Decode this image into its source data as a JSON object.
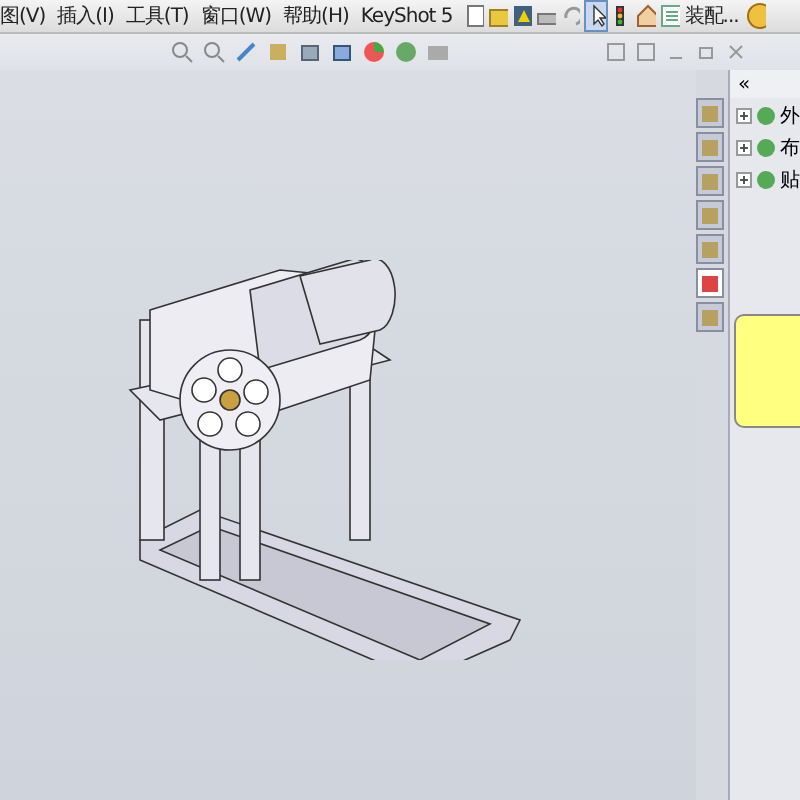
{
  "menu_bar": {
    "items": [
      {
        "label": "图(V)"
      },
      {
        "label": "插入(I)"
      },
      {
        "label": "工具(T)"
      },
      {
        "label": "窗口(W)"
      },
      {
        "label": "帮助(H)"
      },
      {
        "label": "KeyShot 5"
      }
    ],
    "context_label": "装配..."
  },
  "panel": {
    "collapse_glyph": "«",
    "tree": [
      {
        "label": "外"
      },
      {
        "label": "布"
      },
      {
        "label": "贴"
      }
    ],
    "tabs": [
      {
        "selected": false
      },
      {
        "selected": false
      },
      {
        "selected": false
      },
      {
        "selected": false
      },
      {
        "selected": false
      },
      {
        "selected": true
      },
      {
        "selected": false
      }
    ]
  }
}
